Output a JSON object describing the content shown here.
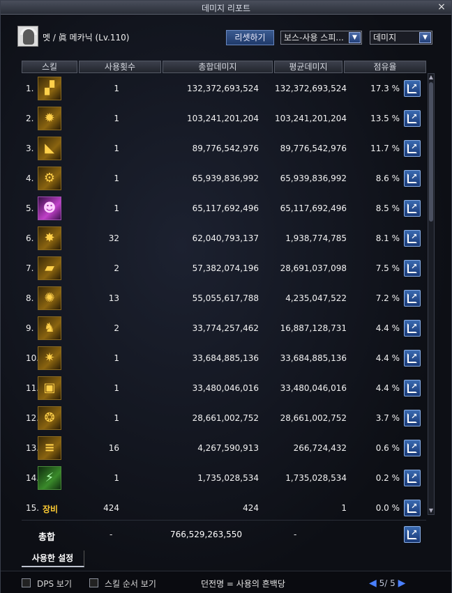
{
  "window": {
    "title": "데미지 리포트",
    "close_icon": "×"
  },
  "header": {
    "char_name": "멧 / 眞 메카닉 (Lv.110)",
    "reset_label": "리셋하기",
    "select_boss": "보스-사용 스피...",
    "select_type": "데미지"
  },
  "columns": [
    "스킬",
    "사용횟수",
    "총합데미지",
    "평균데미지",
    "점유율"
  ],
  "rows": [
    {
      "num": "1.",
      "icon": "gatling-skill-icon",
      "glyph": "▞",
      "style": "",
      "count": "1",
      "total": "132,372,693,524",
      "avg": "132,372,693,524",
      "share": "17.3 %"
    },
    {
      "num": "2.",
      "icon": "missile-skill-icon",
      "glyph": "✹",
      "style": "",
      "count": "1",
      "total": "103,241,201,204",
      "avg": "103,241,201,204",
      "share": "13.5 %"
    },
    {
      "num": "3.",
      "icon": "laser-skill-icon",
      "glyph": "◣",
      "style": "",
      "count": "1",
      "total": "89,776,542,976",
      "avg": "89,776,542,976",
      "share": "11.7 %"
    },
    {
      "num": "4.",
      "icon": "robot-skill-icon",
      "glyph": "⚙",
      "style": "",
      "count": "1",
      "total": "65,939,836,992",
      "avg": "65,939,836,992",
      "share": "8.6 %"
    },
    {
      "num": "5.",
      "icon": "awakening-skill-icon",
      "glyph": "☻",
      "style": "purple",
      "count": "1",
      "total": "65,117,692,496",
      "avg": "65,117,692,496",
      "share": "8.5 %"
    },
    {
      "num": "6.",
      "icon": "explosion-skill-icon",
      "glyph": "✸",
      "style": "",
      "count": "32",
      "total": "62,040,793,137",
      "avg": "1,938,774,785",
      "share": "8.1 %"
    },
    {
      "num": "7.",
      "icon": "cannon-skill-icon",
      "glyph": "▰",
      "style": "",
      "count": "2",
      "total": "57,382,074,196",
      "avg": "28,691,037,098",
      "share": "7.5 %"
    },
    {
      "num": "8.",
      "icon": "burst-skill-icon",
      "glyph": "✺",
      "style": "",
      "count": "13",
      "total": "55,055,617,788",
      "avg": "4,235,047,522",
      "share": "7.2 %"
    },
    {
      "num": "9.",
      "icon": "mech-skill-icon",
      "glyph": "♞",
      "style": "",
      "count": "2",
      "total": "33,774,257,462",
      "avg": "16,887,128,731",
      "share": "4.4 %"
    },
    {
      "num": "10.",
      "icon": "timer-skill-icon",
      "glyph": "✷",
      "style": "",
      "count": "1",
      "total": "33,684,885,136",
      "avg": "33,684,885,136",
      "share": "4.4 %"
    },
    {
      "num": "11.",
      "icon": "drone-skill-icon",
      "glyph": "▣",
      "style": "",
      "count": "1",
      "total": "33,480,046,016",
      "avg": "33,480,046,016",
      "share": "4.4 %"
    },
    {
      "num": "12.",
      "icon": "flame-skill-icon",
      "glyph": "❂",
      "style": "",
      "count": "1",
      "total": "28,661,002,752",
      "avg": "28,661,002,752",
      "share": "3.7 %"
    },
    {
      "num": "13.",
      "icon": "rail-skill-icon",
      "glyph": "≡",
      "style": "",
      "count": "16",
      "total": "4,267,590,913",
      "avg": "266,724,432",
      "share": "0.6 %"
    },
    {
      "num": "14.",
      "icon": "module-skill-icon",
      "glyph": "⚡",
      "style": "green",
      "count": "1",
      "total": "1,735,028,534",
      "avg": "1,735,028,534",
      "share": "0.2 %"
    },
    {
      "num": "15.",
      "icon": "",
      "glyph": "",
      "style": "equip",
      "equip_label": "장비",
      "count": "424",
      "total": "424",
      "avg": "1",
      "share": "0.0 %"
    }
  ],
  "total": {
    "label": "총합",
    "count": "-",
    "total": "766,529,263,550",
    "avg": "-"
  },
  "tabs": {
    "used_settings": "사용한 설정"
  },
  "bottom": {
    "dps_label": "DPS 보기",
    "skill_order_label": "스킬 순서 보기",
    "hint": "던전명 = 사용의 흔백당",
    "page": "5/ 5"
  }
}
